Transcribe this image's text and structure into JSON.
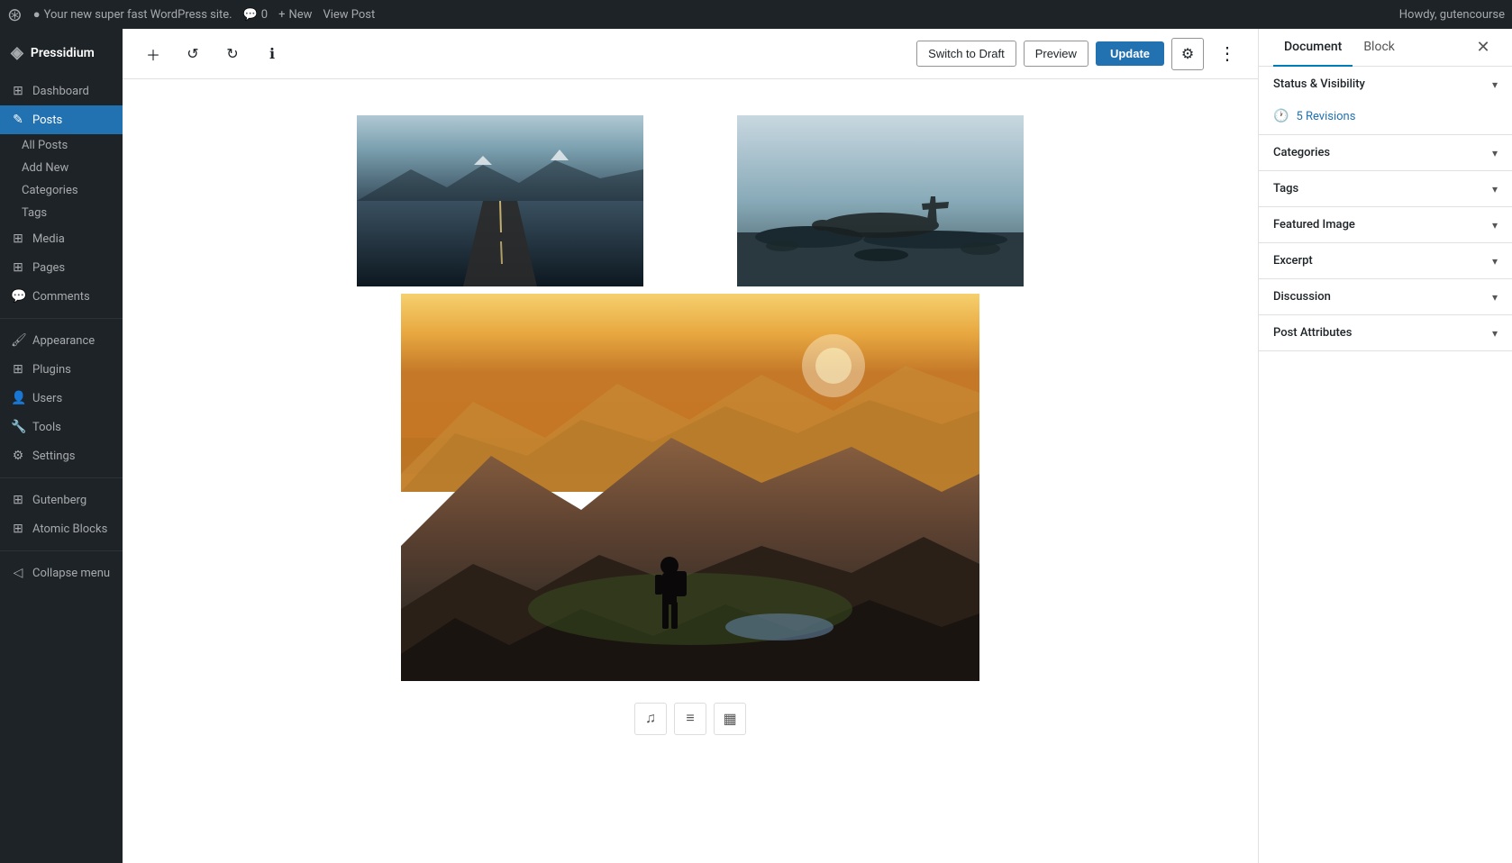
{
  "admin_bar": {
    "site_name": "Your new super fast WordPress site.",
    "comments_count": "0",
    "new_label": "New",
    "view_post_label": "View Post",
    "howdy": "Howdy, gutencourse"
  },
  "sidebar": {
    "brand": "Pressidium",
    "items": [
      {
        "id": "dashboard",
        "label": "Dashboard",
        "icon": "⊞"
      },
      {
        "id": "posts",
        "label": "Posts",
        "icon": "✎",
        "active": true
      },
      {
        "id": "all-posts",
        "label": "All Posts",
        "sub": true
      },
      {
        "id": "add-new",
        "label": "Add New",
        "sub": true
      },
      {
        "id": "categories",
        "label": "Categories",
        "sub": true
      },
      {
        "id": "tags",
        "label": "Tags",
        "sub": true
      },
      {
        "id": "media",
        "label": "Media",
        "icon": "⊞"
      },
      {
        "id": "pages",
        "label": "Pages",
        "icon": "⊞"
      },
      {
        "id": "comments",
        "label": "Comments",
        "icon": "💬"
      },
      {
        "id": "appearance",
        "label": "Appearance",
        "icon": "🖌"
      },
      {
        "id": "plugins",
        "label": "Plugins",
        "icon": "⊞"
      },
      {
        "id": "users",
        "label": "Users",
        "icon": "👤"
      },
      {
        "id": "tools",
        "label": "Tools",
        "icon": "🔧"
      },
      {
        "id": "settings",
        "label": "Settings",
        "icon": "⚙"
      },
      {
        "id": "gutenberg",
        "label": "Gutenberg",
        "icon": "⊞"
      },
      {
        "id": "atomic-blocks",
        "label": "Atomic Blocks",
        "icon": "⊞"
      },
      {
        "id": "collapse-menu",
        "label": "Collapse menu",
        "icon": "◁"
      }
    ]
  },
  "toolbar": {
    "add_block_label": "+",
    "undo_label": "↩",
    "redo_label": "↪",
    "info_label": "ℹ",
    "switch_to_draft_label": "Switch to Draft",
    "preview_label": "Preview",
    "update_label": "Update",
    "settings_label": "⚙",
    "more_label": "⋮"
  },
  "right_panel": {
    "document_tab": "Document",
    "block_tab": "Block",
    "close_icon": "✕",
    "sections": [
      {
        "id": "status-visibility",
        "label": "Status & Visibility",
        "has_chevron": true
      },
      {
        "id": "revisions",
        "label": "5 Revisions",
        "is_revisions": true
      },
      {
        "id": "categories",
        "label": "Categories",
        "has_chevron": true
      },
      {
        "id": "tags",
        "label": "Tags",
        "has_chevron": true
      },
      {
        "id": "featured-image",
        "label": "Featured Image",
        "has_chevron": true
      },
      {
        "id": "excerpt",
        "label": "Excerpt",
        "has_chevron": true
      },
      {
        "id": "discussion",
        "label": "Discussion",
        "has_chevron": true
      },
      {
        "id": "post-attributes",
        "label": "Post Attributes",
        "has_chevron": true
      }
    ]
  },
  "block_tools": [
    {
      "id": "audio",
      "icon": "♫",
      "label": "Audio"
    },
    {
      "id": "list",
      "icon": "≡",
      "label": "List"
    },
    {
      "id": "image",
      "icon": "⊞",
      "label": "Image"
    }
  ]
}
